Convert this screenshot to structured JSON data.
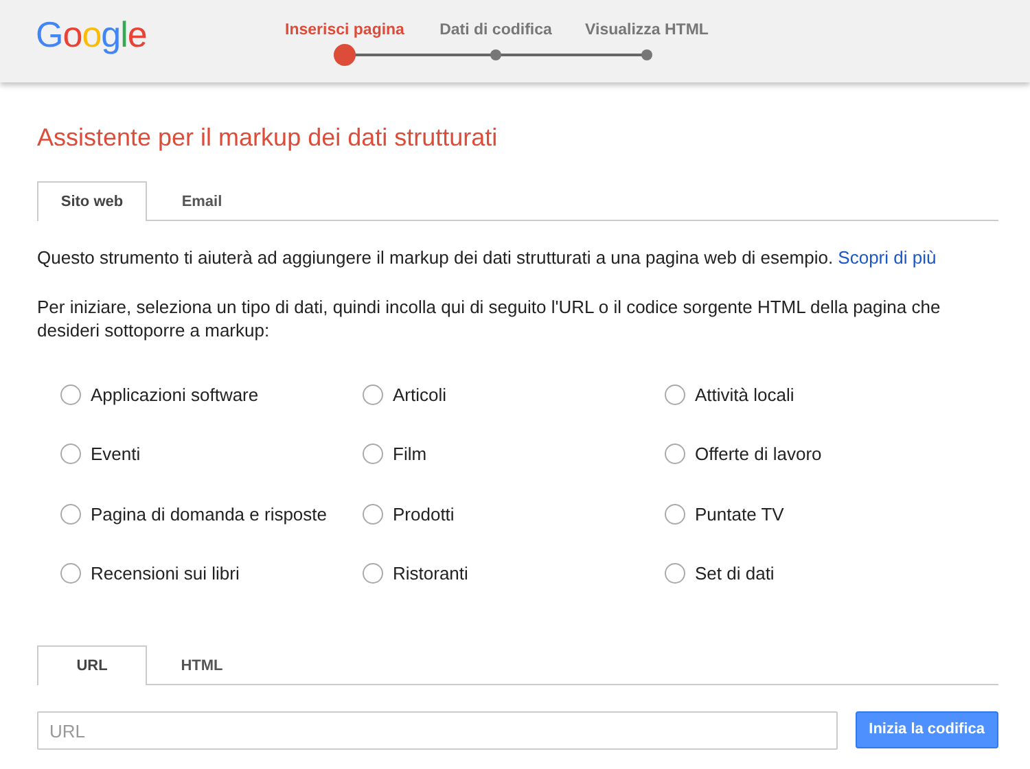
{
  "logo": "Google",
  "steps": [
    {
      "label": "Inserisci pagina",
      "selected": true
    },
    {
      "label": "Dati di codifica",
      "selected": false
    },
    {
      "label": "Visualizza HTML",
      "selected": false
    }
  ],
  "title": "Assistente per il markup dei dati strutturati",
  "source_tabs": [
    {
      "label": "Sito web",
      "selected": true
    },
    {
      "label": "Email",
      "selected": false
    }
  ],
  "intro": "Questo strumento ti aiuterà ad aggiungere il markup dei dati strutturati a una pagina web di esempio.",
  "learn_more": "Scopri di più",
  "instructions": "Per iniziare, seleziona un tipo di dati, quindi incolla qui di seguito l'URL o il codice sorgente HTML della pagina che desideri sottoporre a markup:",
  "data_types": [
    {
      "label": "Applicazioni software",
      "selected": false
    },
    {
      "label": "Articoli",
      "selected": false
    },
    {
      "label": "Attività locali",
      "selected": false
    },
    {
      "label": "Eventi",
      "selected": false
    },
    {
      "label": "Film",
      "selected": false
    },
    {
      "label": "Offerte di lavoro",
      "selected": false
    },
    {
      "label": "Pagina di domanda e risposte",
      "selected": false
    },
    {
      "label": "Prodotti",
      "selected": false
    },
    {
      "label": "Puntate TV",
      "selected": false
    },
    {
      "label": "Recensioni sui libri",
      "selected": false
    },
    {
      "label": "Ristoranti",
      "selected": false
    },
    {
      "label": "Set di dati",
      "selected": false
    }
  ],
  "input_tabs": [
    {
      "label": "URL",
      "selected": true
    },
    {
      "label": "HTML",
      "selected": false
    }
  ],
  "url_field": {
    "placeholder": "URL"
  },
  "start_button": "Inizia la codifica"
}
